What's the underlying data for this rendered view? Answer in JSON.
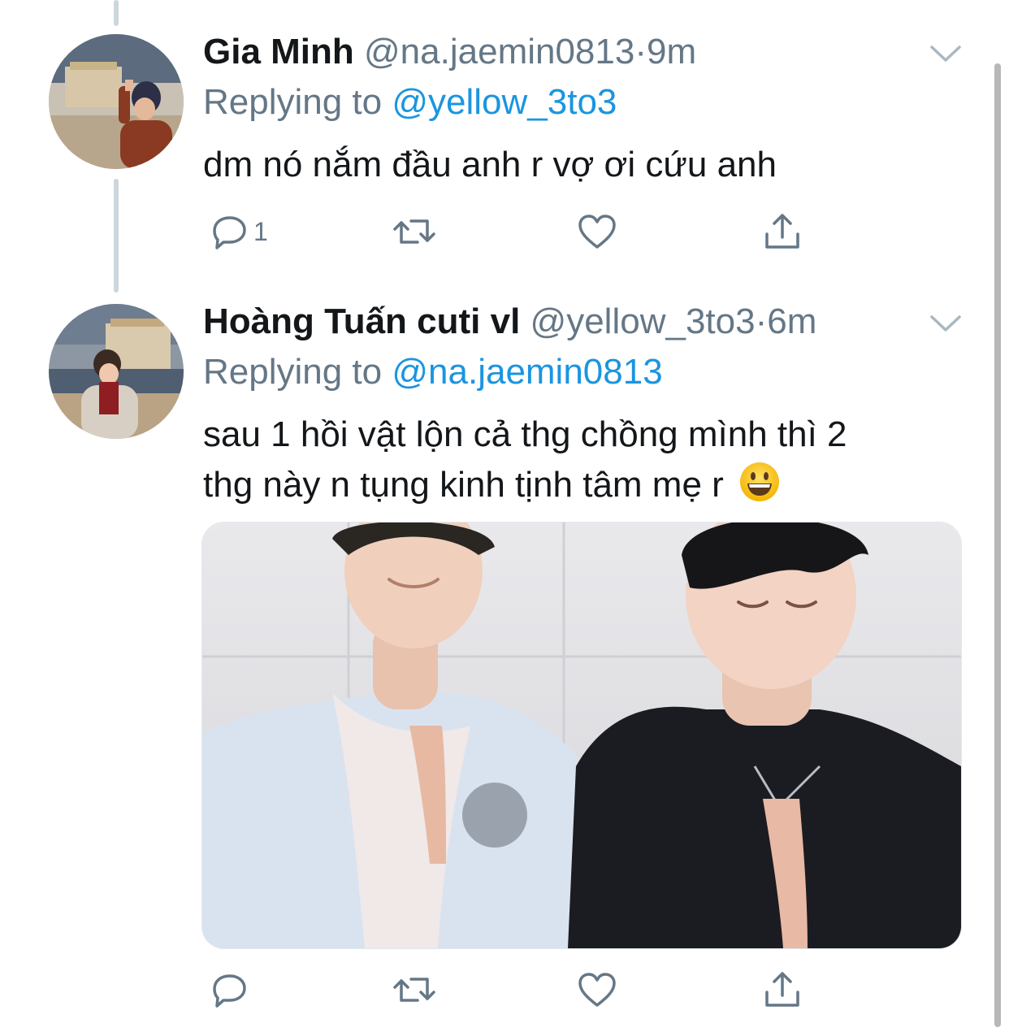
{
  "tweets": [
    {
      "name": "Gia Minh",
      "handle": "@na.jaemin0813",
      "separator": "·",
      "time": "9m",
      "replying_prefix": "Replying to ",
      "replying_to": "@yellow_3to3",
      "text": "dm nó nắm đầu anh r vợ ơi cứu anh",
      "reply_count": "1"
    },
    {
      "name": "Hoàng Tuấn cuti vl",
      "handle": "@yellow_3to3",
      "separator": "·",
      "time": "6m",
      "replying_prefix": "Replying to ",
      "replying_to": "@na.jaemin0813",
      "text_line1": "sau 1 hồi vật lộn cả thg chồng mình thì 2",
      "text_line2": "thg này n tụng kinh tịnh tâm mẹ r",
      "emoji": "grinning-face-emoji"
    }
  ],
  "icons": {
    "reply": "reply-icon",
    "retweet": "retweet-icon",
    "like": "heart-icon",
    "share": "share-icon",
    "more": "chevron-down-icon"
  },
  "colors": {
    "text": "#14171a",
    "secondary": "#657786",
    "link": "#1b95e0",
    "thread_line": "#ccd6dd",
    "icon": "#657786"
  }
}
